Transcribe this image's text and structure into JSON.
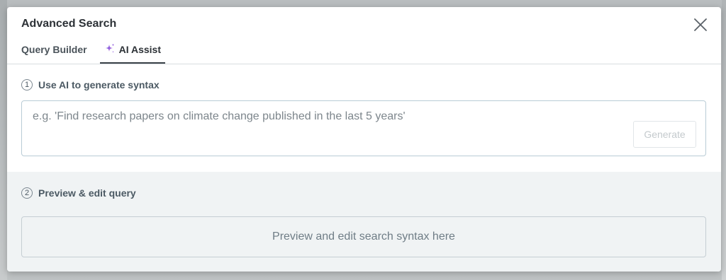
{
  "dialog": {
    "title": "Advanced Search",
    "close_icon": "close-icon"
  },
  "tabs": [
    {
      "label": "Query Builder",
      "active": false
    },
    {
      "label": "AI Assist",
      "active": true,
      "icon": "sparkle-icon"
    }
  ],
  "step1": {
    "number": "1",
    "heading": "Use AI to generate syntax",
    "input_placeholder": "e.g. 'Find research papers on climate change published in the last 5 years'",
    "input_value": "",
    "generate_label": "Generate",
    "generate_enabled": false
  },
  "step2": {
    "number": "2",
    "heading": "Preview & edit query",
    "preview_placeholder": "Preview and edit search syntax here"
  },
  "colors": {
    "sparkle_start": "#6b5be6",
    "sparkle_end": "#c06bd6",
    "active_tab_underline": "#3a4248",
    "section2_background": "#f0f3f4"
  }
}
